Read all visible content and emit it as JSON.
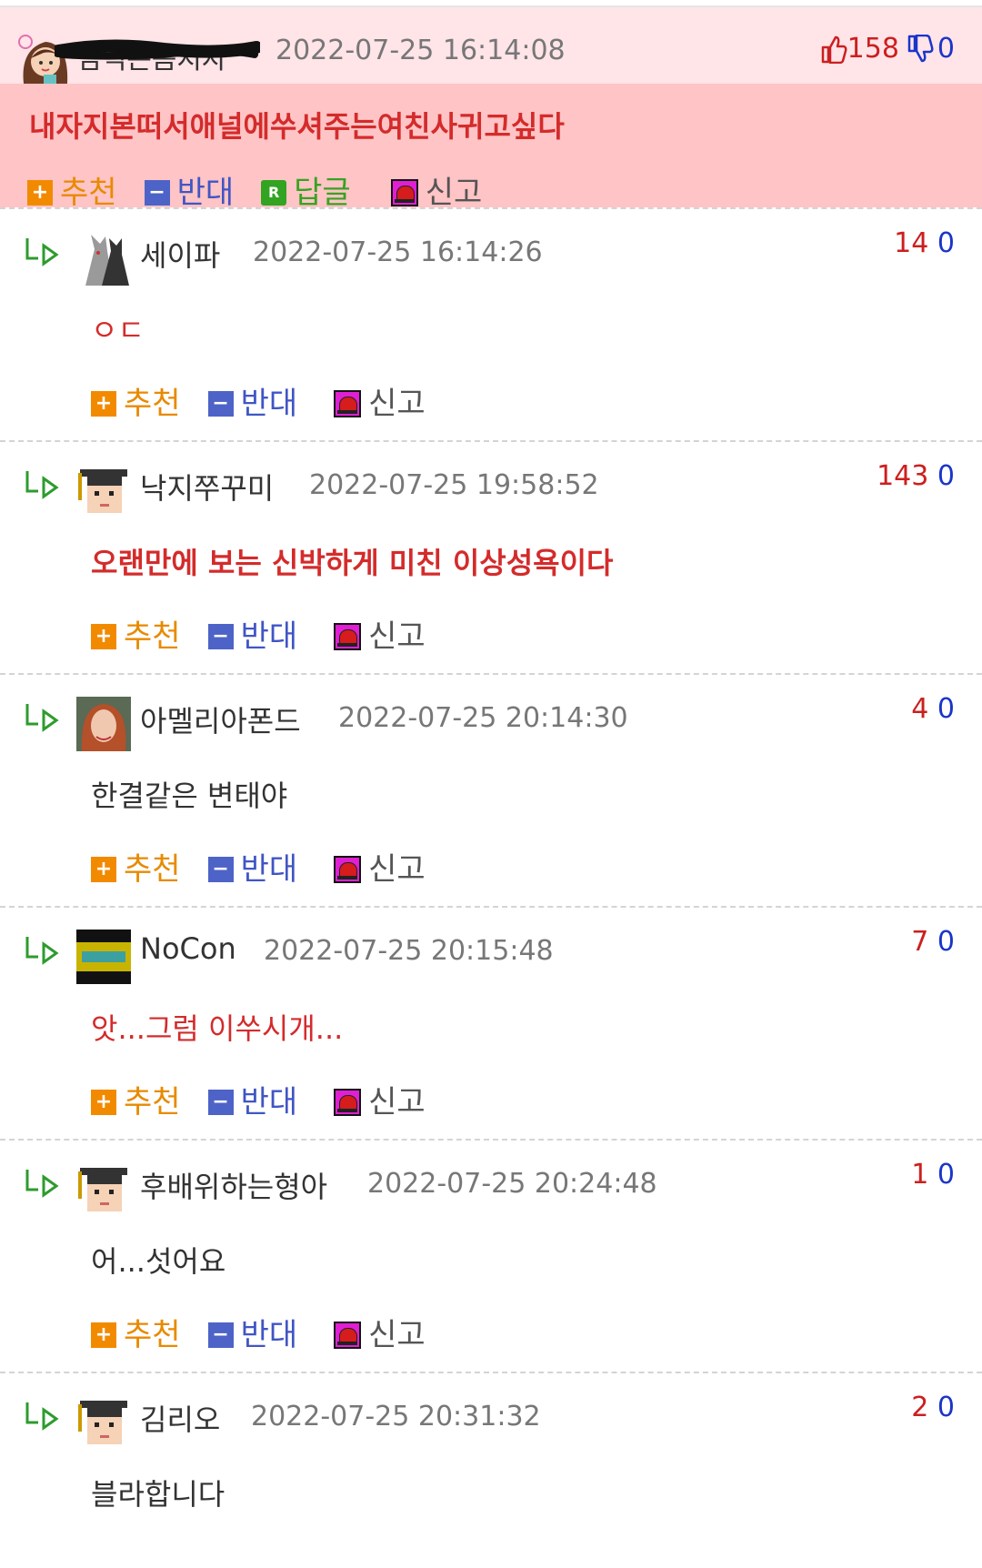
{
  "main": {
    "nickname": "임떡은좀지자",
    "date": "2022-07-25 16:14:08",
    "up": "158",
    "down": "0",
    "text": "내자지본떠서애널에쑤셔주는여친사귀고싶다",
    "actions": {
      "recommend": "추천",
      "oppose": "반대",
      "reply": "답글",
      "report": "신고"
    }
  },
  "replies": [
    {
      "nickname": "세이파",
      "date": "2022-07-25 16:14:26",
      "up": "14",
      "down": "0",
      "text": "ㅇㄷ",
      "avatar": "cats-avatar-icon"
    },
    {
      "nickname": "낙지쭈꾸미",
      "date": "2022-07-25 19:58:52",
      "up": "143",
      "down": "0",
      "text": "오랜만에 보는 신박하게 미친 이상성욕이다",
      "avatar": "graduate-avatar-icon"
    },
    {
      "nickname": "아멜리아폰드",
      "date": "2022-07-25 20:14:30",
      "up": "4",
      "down": "0",
      "text": "한결같은 변태야",
      "avatar": "photo-avatar-icon"
    },
    {
      "nickname": "NoCon",
      "date": "2022-07-25 20:15:48",
      "up": "7",
      "down": "0",
      "text": "앗...그럼 이쑤시개...",
      "avatar": "nocon-avatar-icon"
    },
    {
      "nickname": "후배위하는형아",
      "date": "2022-07-25 20:24:48",
      "up": "1",
      "down": "0",
      "text": "어...섯어요",
      "avatar": "graduate-avatar-icon"
    },
    {
      "nickname": "김리오",
      "date": "2022-07-25 20:31:32",
      "up": "2",
      "down": "0",
      "text": "블라합니다",
      "avatar": "graduate-avatar-icon"
    }
  ],
  "actions": {
    "recommend": "추천",
    "oppose": "반대",
    "report": "신고"
  },
  "colors": {
    "up": "#cc1f1f",
    "down": "#1a35c9",
    "accent_bg": "#ffc4c6",
    "header_bg": "#ffe4e8"
  }
}
